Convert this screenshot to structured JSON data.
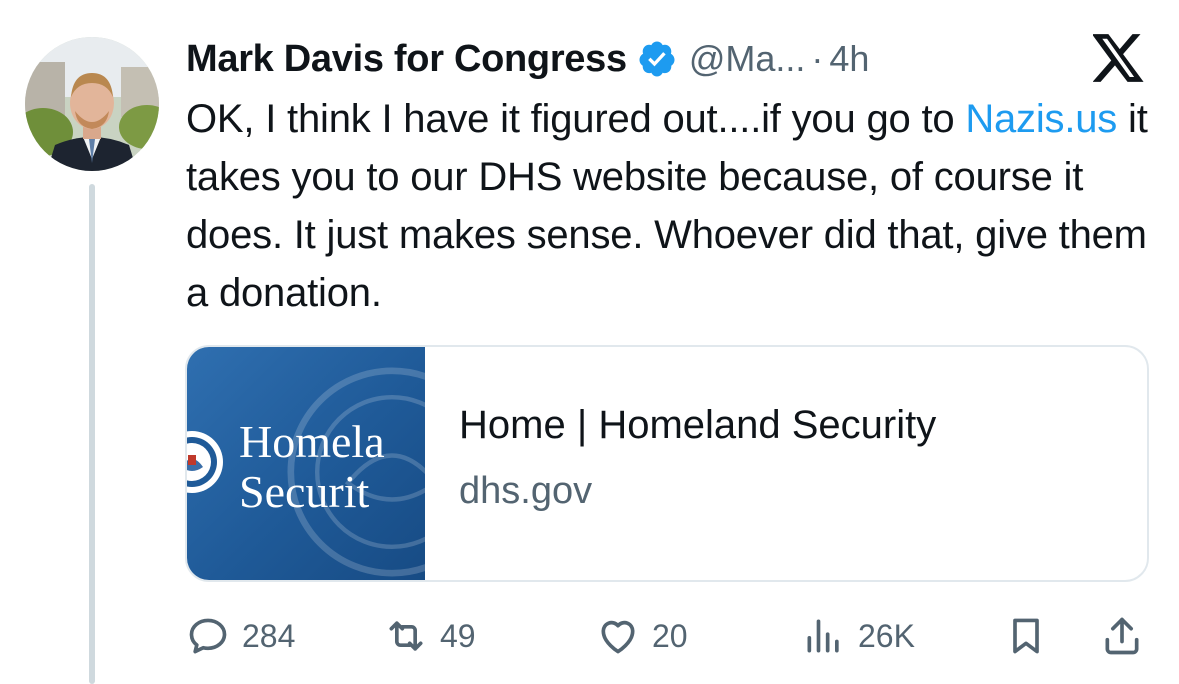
{
  "tweet": {
    "author_name": "Mark Davis for Congress",
    "handle": "@Ma...",
    "separator": "·",
    "time": "4h",
    "text_part1": "OK, I think I have it figured out....if you go to ",
    "link_text": "Nazis.us",
    "text_part2": " it takes you to our DHS website because, of course it does.  It just makes sense. Whoever did that, give them a donation."
  },
  "card": {
    "image_brand_line1": "Homela",
    "image_brand_line2": "Securit",
    "title": "Home | Homeland Security",
    "domain": "dhs.gov"
  },
  "actions": {
    "replies": "284",
    "retweets": "49",
    "likes": "20",
    "views": "26K"
  },
  "icons": {
    "verified": "verified-badge-icon",
    "platform": "x-logo-icon",
    "reply": "reply-icon",
    "retweet": "retweet-icon",
    "like": "heart-icon",
    "views": "views-icon",
    "bookmark": "bookmark-icon",
    "share": "share-icon"
  },
  "colors": {
    "link": "#1d9bf0",
    "secondary_text": "#536471",
    "verified": "#1d9bf0",
    "card_image_bg": "#1f5a98"
  }
}
